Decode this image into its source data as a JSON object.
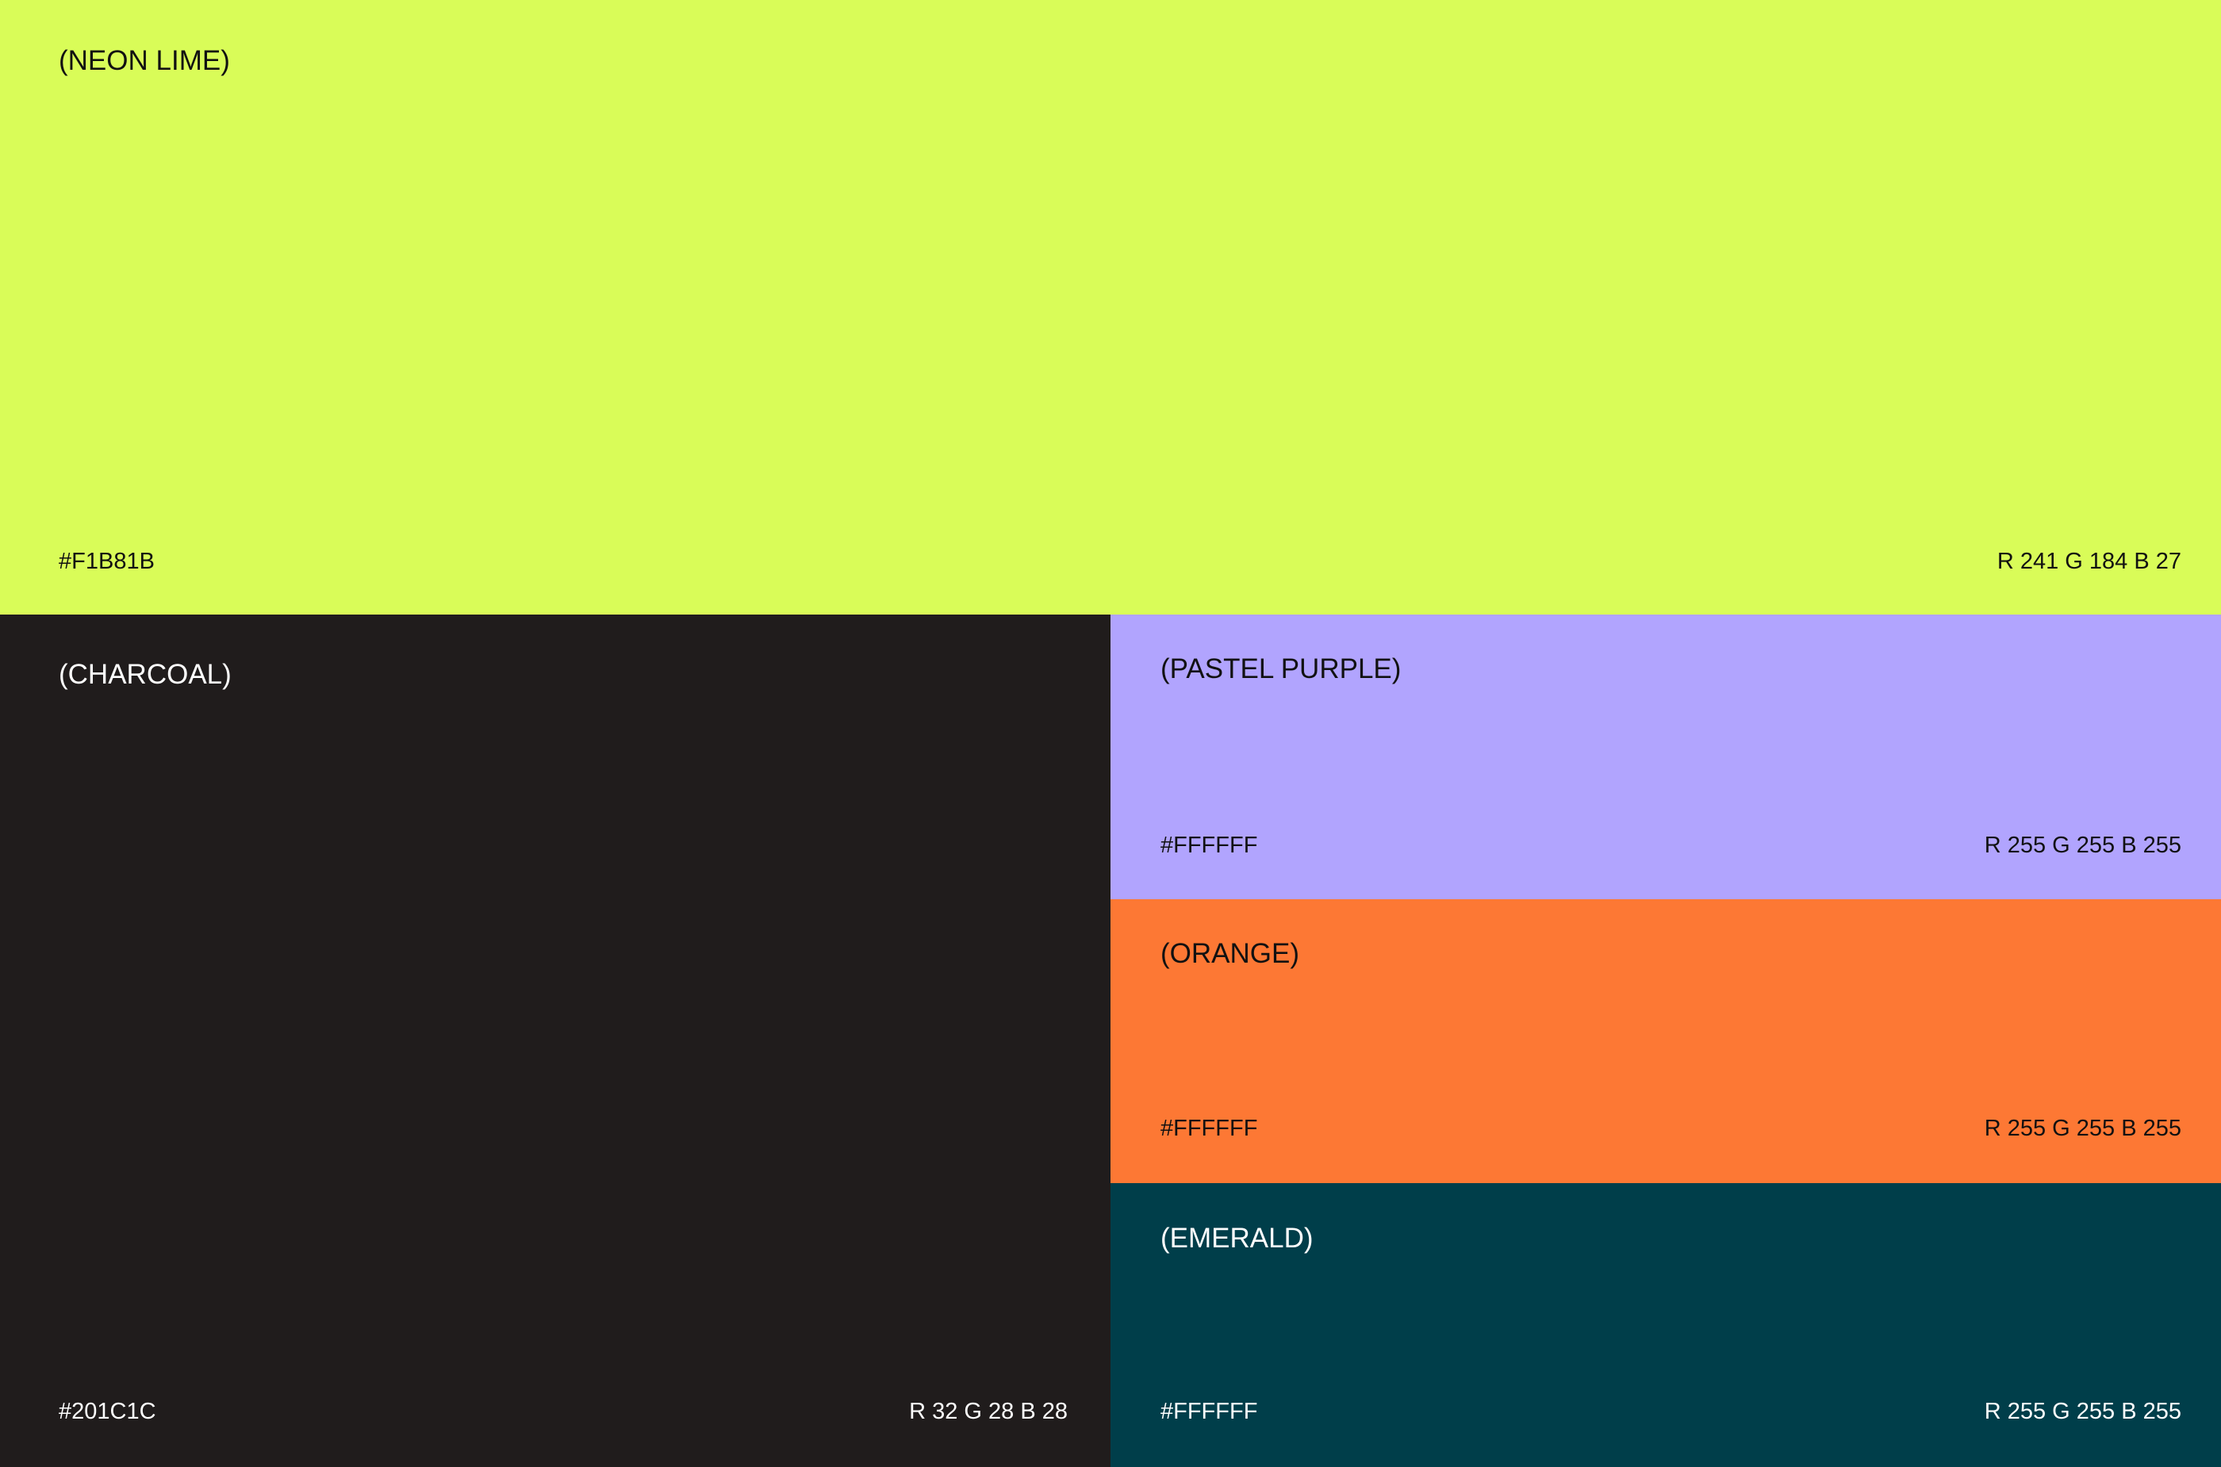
{
  "swatches": {
    "neon_lime": {
      "name": "(NEON LIME)",
      "hex_label": "#F1B81B",
      "rgb_label": "R 241 G 184  B 27",
      "fill_color": "#D9FC58",
      "text_color": "#111111"
    },
    "charcoal": {
      "name": "(CHARCOAL)",
      "hex_label": "#201C1C",
      "rgb_label": "R 32 G 28  B 28",
      "fill_color": "#201C1C",
      "text_color": "#FFFFFF"
    },
    "pastel_purple": {
      "name": "(PASTEL PURPLE)",
      "hex_label": "#FFFFFF",
      "rgb_label": "R 255 G 255  B 255",
      "fill_color": "#B1A4FE",
      "text_color": "#111111"
    },
    "orange": {
      "name": "(ORANGE)",
      "hex_label": "#FFFFFF",
      "rgb_label": "R 255 G 255  B 255",
      "fill_color": "#FD7834",
      "text_color": "#111111"
    },
    "emerald": {
      "name": "(EMERALD)",
      "hex_label": "#FFFFFF",
      "rgb_label": "R 255 G 255  B 255",
      "fill_color": "#003E4A",
      "text_color": "#FFFFFF"
    }
  }
}
